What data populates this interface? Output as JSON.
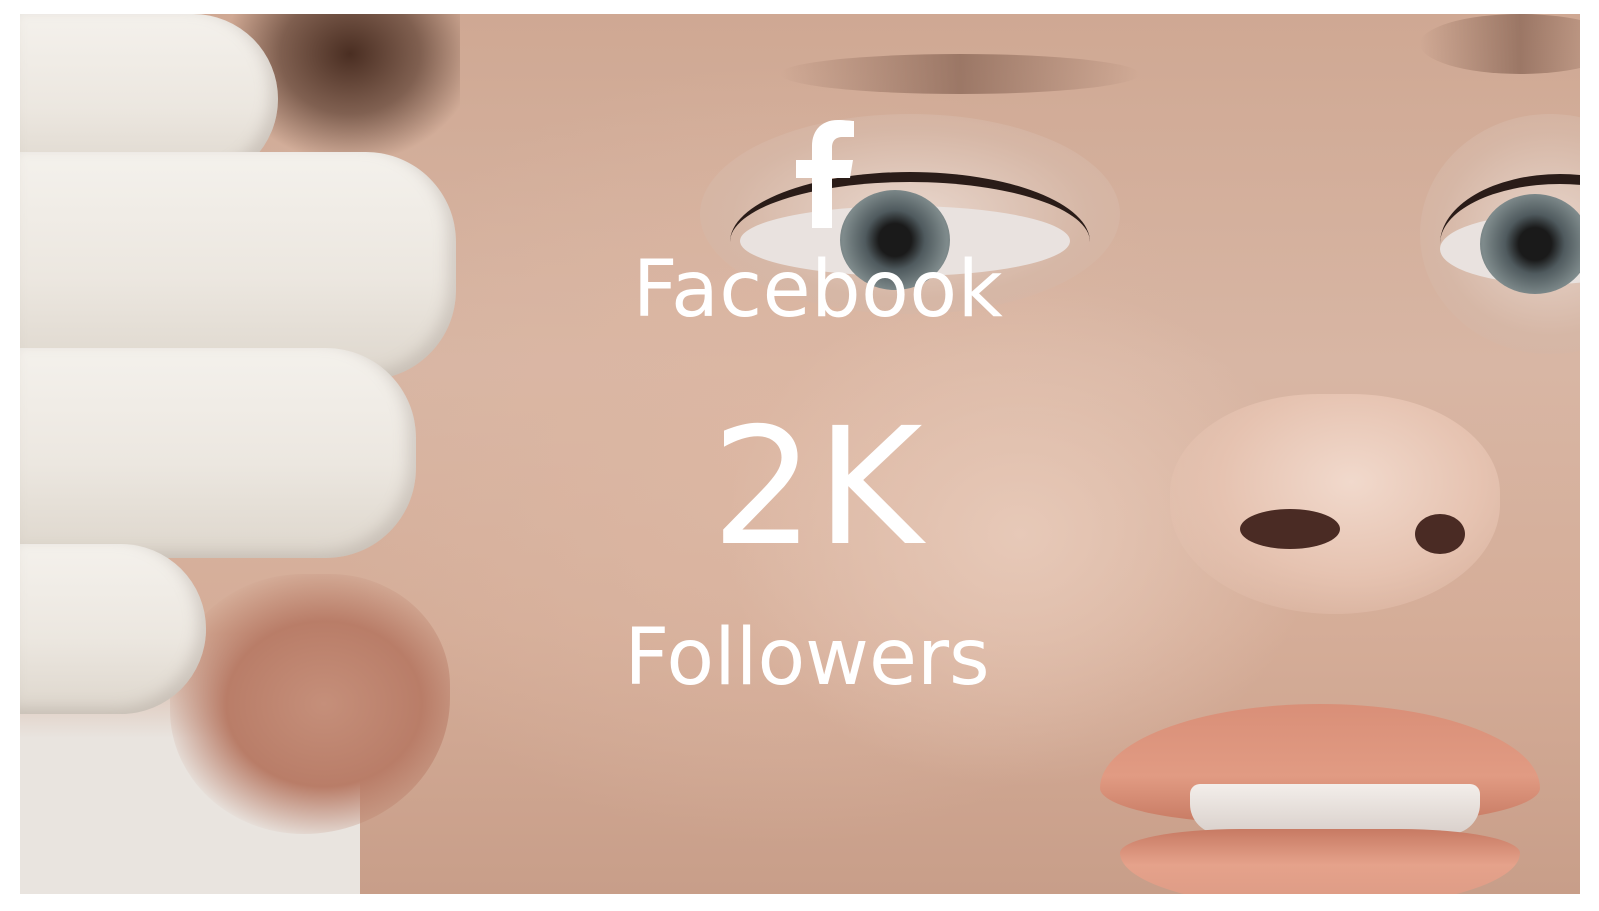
{
  "social_stat": {
    "icon": "facebook-icon",
    "platform": "Facebook",
    "count": "2K",
    "label": "Followers",
    "text_color": "#ffffff"
  }
}
